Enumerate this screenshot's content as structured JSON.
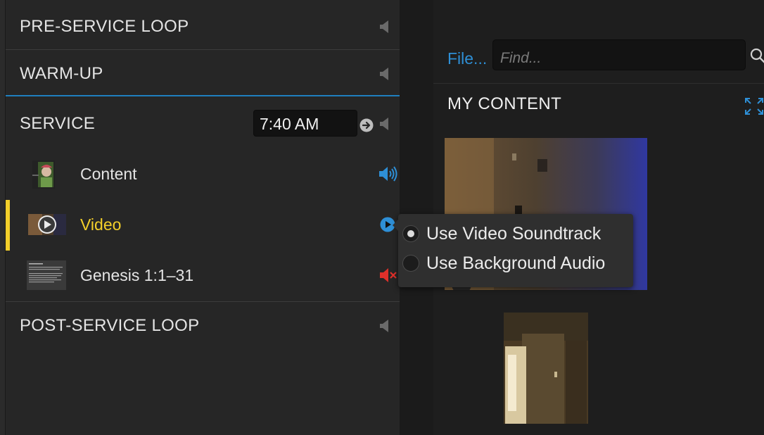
{
  "sections": {
    "pre_service": "PRE-SERVICE LOOP",
    "warm_up": "WARM-UP",
    "service": "SERVICE",
    "service_time": "7:40 AM",
    "post_service": "POST-SERVICE LOOP"
  },
  "service_items": [
    {
      "label": "Content",
      "audio": "speaker-on-icon"
    },
    {
      "label": "Video",
      "audio": "play-circle-icon",
      "active": true
    },
    {
      "label": "Genesis 1:1–31",
      "audio": "speaker-muted-icon"
    }
  ],
  "audio_popup": {
    "options": [
      {
        "label": "Use Video Soundtrack",
        "selected": true
      },
      {
        "label": "Use Background Audio",
        "selected": false
      }
    ]
  },
  "library": {
    "file_link": "File...",
    "search_placeholder": "Find...",
    "heading": "MY CONTENT"
  },
  "colors": {
    "accent_blue": "#2e8fd6",
    "active_yellow": "#f3cf2a",
    "muted_red": "#e0302a"
  }
}
